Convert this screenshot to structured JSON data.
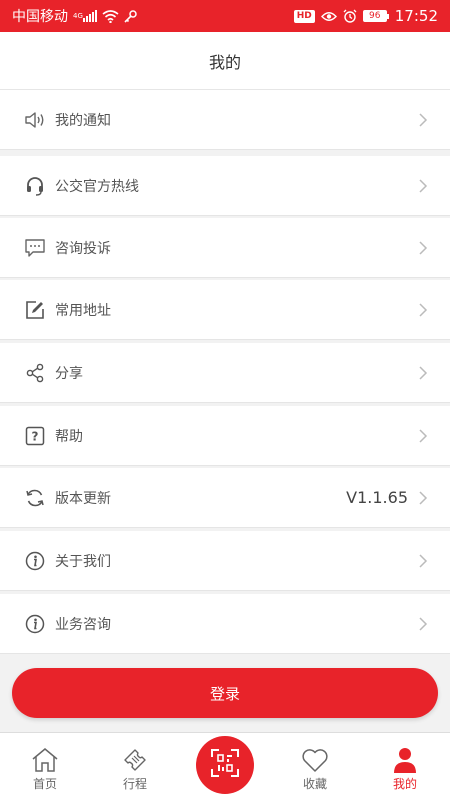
{
  "status_bar": {
    "carrier": "中国移动",
    "network": "4G",
    "hd": "HD",
    "battery": "96",
    "time": "17:52"
  },
  "header": {
    "title": "我的"
  },
  "menu": [
    {
      "label": "我的通知",
      "icon": "speaker-icon"
    },
    {
      "label": "公交官方热线",
      "icon": "headset-icon"
    },
    {
      "label": "咨询投诉",
      "icon": "chat-bubble-icon"
    },
    {
      "label": "常用地址",
      "icon": "edit-icon"
    },
    {
      "label": "分享",
      "icon": "share-icon"
    },
    {
      "label": "帮助",
      "icon": "help-icon"
    },
    {
      "label": "版本更新",
      "icon": "refresh-icon",
      "value": "V1.1.65"
    },
    {
      "label": "关于我们",
      "icon": "info-icon"
    },
    {
      "label": "业务咨询",
      "icon": "info-icon"
    }
  ],
  "login_button": "登录",
  "tabbar": [
    {
      "label": "首页",
      "icon": "home-icon"
    },
    {
      "label": "行程",
      "icon": "ticket-icon"
    },
    {
      "label": "",
      "icon": "qr-scan-icon"
    },
    {
      "label": "收藏",
      "icon": "heart-icon"
    },
    {
      "label": "我的",
      "icon": "person-icon",
      "active": true
    }
  ],
  "colors": {
    "accent": "#e8232a",
    "icon_gray": "#666666",
    "chevron": "#bbbbbb"
  }
}
